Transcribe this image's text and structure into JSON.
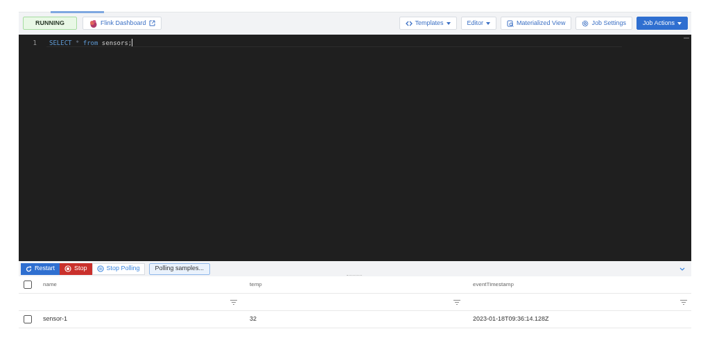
{
  "status": {
    "label": "RUNNING"
  },
  "dashboard_link": {
    "label": "Flink Dashboard"
  },
  "toolbar_buttons": [
    {
      "label": "Templates",
      "kind": "templates",
      "caret": true,
      "primary": false
    },
    {
      "label": "Editor",
      "kind": "plain",
      "caret": true,
      "primary": false
    },
    {
      "label": "Materialized View",
      "kind": "view",
      "caret": false,
      "primary": false
    },
    {
      "label": "Job Settings",
      "kind": "settings",
      "caret": false,
      "primary": false
    },
    {
      "label": "Job Actions",
      "kind": "plain",
      "caret": true,
      "primary": true
    }
  ],
  "editor": {
    "lines": [
      {
        "number": "1",
        "tokens": [
          {
            "text": "SELECT",
            "kind": "keyword"
          },
          {
            "text": "*",
            "kind": "operator"
          },
          {
            "text": "from",
            "kind": "keyword"
          },
          {
            "text": "sensors;",
            "kind": "identifier"
          }
        ]
      }
    ]
  },
  "results_actions": [
    {
      "label": "Restart",
      "kind": "restart"
    },
    {
      "label": "Stop",
      "kind": "stop"
    },
    {
      "label": "Stop Polling",
      "kind": "stop-polling"
    }
  ],
  "polling_status": "Polling samples...",
  "table": {
    "select_all": {
      "checked": false
    },
    "columns": [
      "name",
      "temp",
      "eventTimestamp"
    ],
    "rows": [
      {
        "checked": false,
        "cells": [
          "sensor-1",
          "32",
          "2023-01-18T09:36:14.128Z"
        ]
      }
    ]
  }
}
